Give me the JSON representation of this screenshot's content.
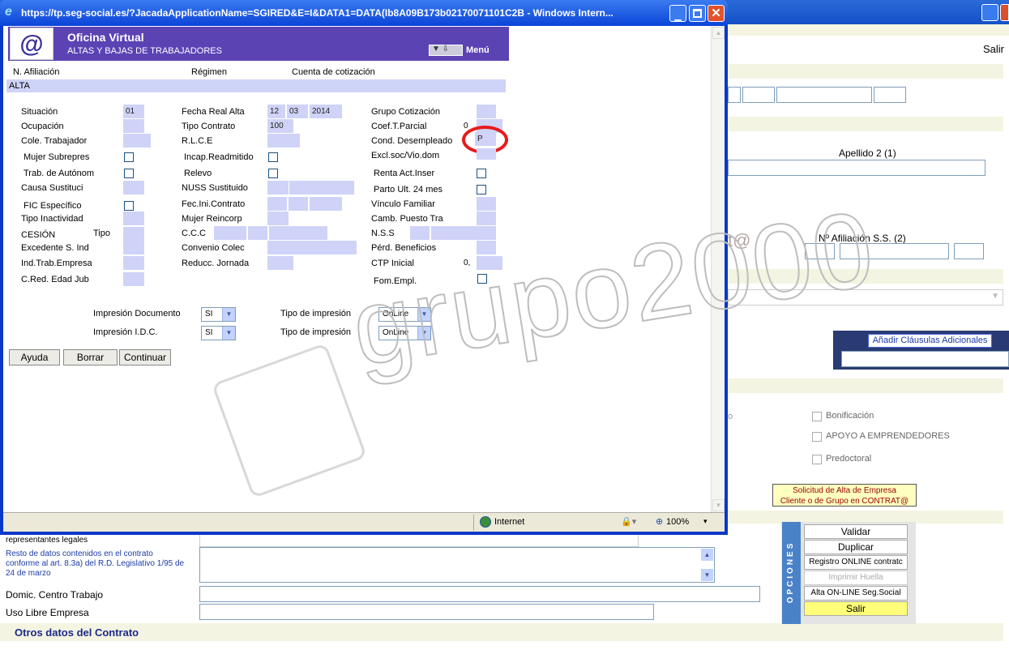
{
  "bg_window": {
    "salir_top": "Salir",
    "apellido2_label": "Apellido  2 (1)",
    "afiliacion_label": "Nº Afiliación S.S. (2)",
    "anadir_btn": "Añadir Cláusulas Adicionales",
    "bonificacion": "Bonificación",
    "apoyo": "APOYO A EMPRENDEDORES",
    "predoctoral": "Predoctoral",
    "solicitud_line1": "Solicitud de Alta de Empresa",
    "solicitud_line2": "Cliente o de Grupo en CONTRAT@",
    "representantes": "representantes legales",
    "resto_datos": "Resto de datos contenidos en el contrato conforme al art. 8.3a) del R.D. Legislativo 1/95 de 24 de marzo",
    "domic": "Domic. Centro Trabajo",
    "uso_libre": "Uso Libre Empresa",
    "otros_datos": "Otros datos del Contrato",
    "opciones_title": "OPCIONES",
    "opciones": [
      "Validar",
      "Duplicar",
      "Registro ONLINE contratc",
      "Imprimir Huella",
      "Alta ON-LINE Seg.Social",
      "Salir"
    ],
    "watermark": "grupo2000",
    "partial_text": "t@",
    "partial_o": "o"
  },
  "popup": {
    "title": "https://tp.seg-social.es/?JacadaApplicationName=SGIRED&E=I&DATA1=DATA(Ib8A09B173b02170071101C2B - Windows Intern...",
    "header_title": "Oficina Virtual",
    "header_subtitle": "ALTAS Y BAJAS DE TRABAJADORES",
    "menu_label": "Menú",
    "col_afiliacion": "N. Afiliación",
    "col_regimen": "Régimen",
    "col_cuenta": "Cuenta de cotización",
    "section": "ALTA",
    "labels": {
      "situacion": "Situación",
      "ocupacion": "Ocupación",
      "cole": "Cole. Trabajador",
      "mujer_sub": "Mujer Subrepres",
      "trab_aut": "Trab. de Autónom",
      "causa": "Causa Sustituci",
      "fic": "FIC Específico",
      "tipo_inact": "Tipo Inactividad",
      "cesion": "CESIÓN",
      "tipo": "Tipo",
      "excedente": "Excedente S. Ind",
      "ind_trab": "Ind.Trab.Empresa",
      "cred": "C.Red. Edad Jub",
      "fecha_real": "Fecha Real Alta",
      "tipo_contrato": "Tipo Contrato",
      "rlce": "R.L.C.E",
      "incap": "Incap.Readmitido",
      "relevo": "Relevo",
      "nuss": "NUSS Sustituido",
      "fec_ini": "Fec.Ini.Contrato",
      "mujer_rein": "Mujer Reincorp",
      "ccc": "C.C.C",
      "convenio": "Convenio Colec",
      "reducc": "Reducc. Jornada",
      "grupo": "Grupo Cotización",
      "coef": "Coef.T.Parcial",
      "cond": "Cond. Desempleado",
      "excl": "Excl.soc/Vio.dom",
      "renta": "Renta Act.Inser",
      "parto": "Parto Ult. 24 mes",
      "vinculo": "Vínculo Familiar",
      "camb": "Camb. Puesto Tra",
      "nss": "N.S.S",
      "perd": "Pérd. Beneficios",
      "ctp": "CTP Inicial",
      "fom": "Fom.Empl."
    },
    "values": {
      "situacion": "01",
      "dia": "12",
      "mes": "03",
      "anio": "2014",
      "tipo_contrato": "100",
      "coef_prefix": "0",
      "cond": "P",
      "ctp_prefix": "0,"
    },
    "impresion_doc": "Impresión Documento",
    "impresion_idc": "Impresión I.D.C.",
    "tipo_impresion": "Tipo de impresión",
    "si": "SI",
    "online": "OnLine",
    "btn_ayuda": "Ayuda",
    "btn_borrar": "Borrar",
    "btn_continuar": "Continuar",
    "status_zone": "Internet",
    "zoom": "100%"
  }
}
